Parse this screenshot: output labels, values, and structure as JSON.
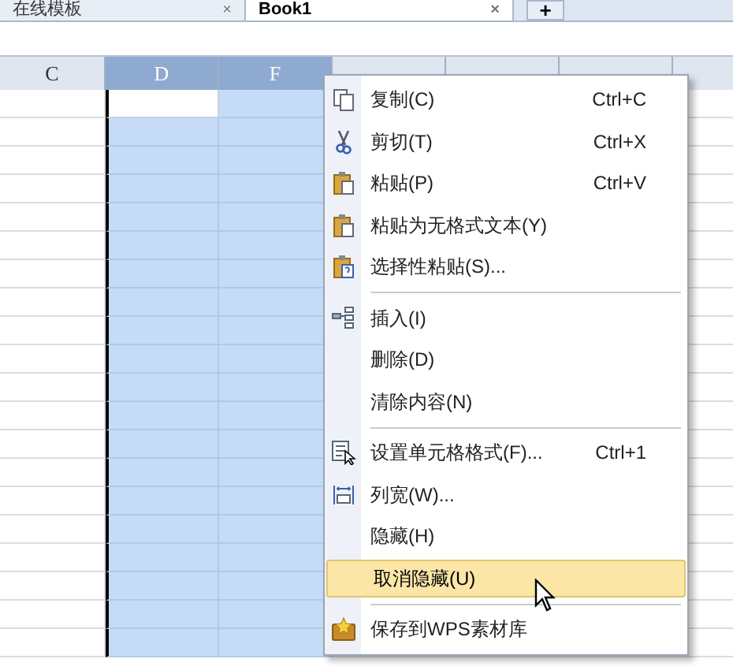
{
  "tabs": [
    {
      "label": "在线模板",
      "selected": false,
      "close": "×"
    },
    {
      "label": "Book1",
      "selected": true,
      "close": "×"
    }
  ],
  "new_tab": "+",
  "columns": [
    {
      "label": "C",
      "selected": false
    },
    {
      "label": "D",
      "selected": true
    },
    {
      "label": "F",
      "selected": true
    },
    {
      "selected": false
    },
    {
      "selected": false
    },
    {
      "selected": false
    }
  ],
  "context_menu": [
    {
      "kind": "item",
      "label": "复制(C)",
      "shortcut": "Ctrl+C",
      "selected": false
    },
    {
      "kind": "item",
      "label": "剪切(T)",
      "shortcut": "Ctrl+X",
      "selected": false
    },
    {
      "kind": "item",
      "label": "粘贴(P)",
      "shortcut": "Ctrl+V",
      "selected": false
    },
    {
      "kind": "item",
      "label": "粘贴为无格式文本(Y)",
      "selected": false
    },
    {
      "kind": "item",
      "label": "选择性粘贴(S)...",
      "selected": false
    },
    {
      "kind": "separator"
    },
    {
      "kind": "item",
      "label": "插入(I)",
      "selected": false
    },
    {
      "kind": "item",
      "label": "删除(D)",
      "selected": false
    },
    {
      "kind": "item",
      "label": "清除内容(N)",
      "selected": false
    },
    {
      "kind": "separator"
    },
    {
      "kind": "item",
      "label": "设置单元格格式(F)...",
      "shortcut": "Ctrl+1",
      "selected": false
    },
    {
      "kind": "item",
      "label": "列宽(W)...",
      "selected": false
    },
    {
      "kind": "item",
      "label": "隐藏(H)",
      "selected": false
    },
    {
      "kind": "item",
      "label": "取消隐藏(U)",
      "selected": true
    },
    {
      "kind": "separator"
    },
    {
      "kind": "item",
      "label": "保存到WPS素材库",
      "selected": false
    }
  ]
}
